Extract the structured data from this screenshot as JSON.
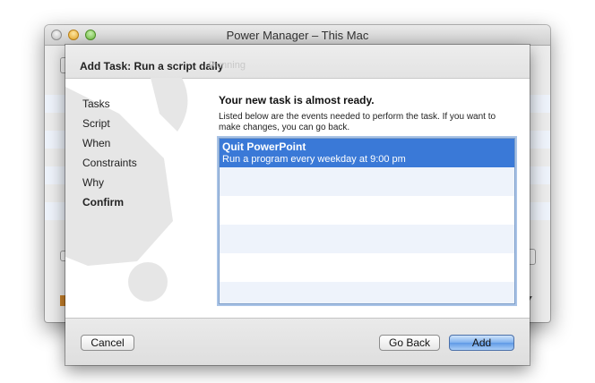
{
  "window": {
    "title": "Power Manager – This Mac"
  },
  "sheet": {
    "title": "Add Task: Run a script daily",
    "ghost_text": "Running",
    "steps": [
      {
        "label": "Tasks"
      },
      {
        "label": "Script"
      },
      {
        "label": "When"
      },
      {
        "label": "Constraints"
      },
      {
        "label": "Why"
      },
      {
        "label": "Confirm",
        "current": true
      }
    ],
    "heading": "Your new task is almost ready.",
    "description": "Listed below are the events needed to perform the task. If you want to make changes, you can go back.",
    "tasks": [
      {
        "name": "Quit PowerPoint",
        "description": "Run a program every weekday at 9:00 pm",
        "selected": true
      }
    ],
    "buttons": {
      "cancel": "Cancel",
      "back": "Go Back",
      "add": "Add"
    }
  },
  "colors": {
    "selection": "#3a79d7",
    "list_stripe": "#eef3fb",
    "primary_button": "#6fa6ea"
  }
}
